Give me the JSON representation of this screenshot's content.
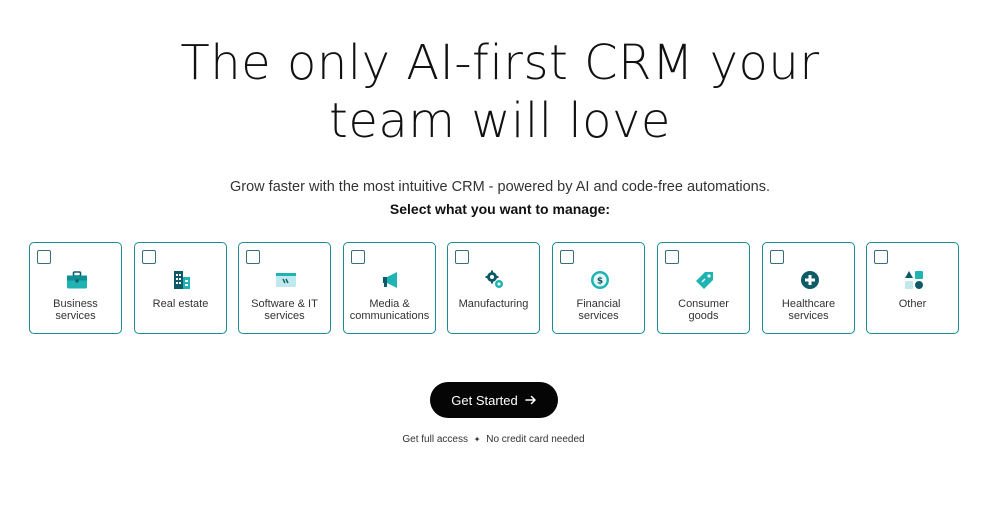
{
  "hero": {
    "title_line1": "The only AI-first CRM your",
    "title_line2": "team will love",
    "subtitle": "Grow faster with the most intuitive CRM - powered by AI and code-free automations.",
    "select_prompt": "Select what you want to manage:"
  },
  "options": [
    {
      "label": "Business\nservices",
      "icon": "briefcase-icon",
      "checked": false
    },
    {
      "label": "Real estate",
      "icon": "building-icon",
      "checked": false
    },
    {
      "label": "Software & IT\nservices",
      "icon": "code-window-icon",
      "checked": false
    },
    {
      "label": "Media &\ncommunications",
      "icon": "megaphone-icon",
      "checked": false
    },
    {
      "label": "Manufacturing",
      "icon": "gears-icon",
      "checked": false
    },
    {
      "label": "Financial\nservices",
      "icon": "dollar-coin-icon",
      "checked": false
    },
    {
      "label": "Consumer\ngoods",
      "icon": "price-tag-icon",
      "checked": false
    },
    {
      "label": "Healthcare\nservices",
      "icon": "medical-cross-icon",
      "checked": false
    },
    {
      "label": "Other",
      "icon": "shapes-icon",
      "checked": false
    }
  ],
  "cta": {
    "label": "Get Started"
  },
  "footnote": {
    "left": "Get full access",
    "separator": "✦",
    "right": "No credit card needed"
  },
  "colors": {
    "accent": "#1fb3b3",
    "accent_dark": "#0e5a66",
    "card_border": "#1a8c95",
    "button_bg": "#050505"
  }
}
